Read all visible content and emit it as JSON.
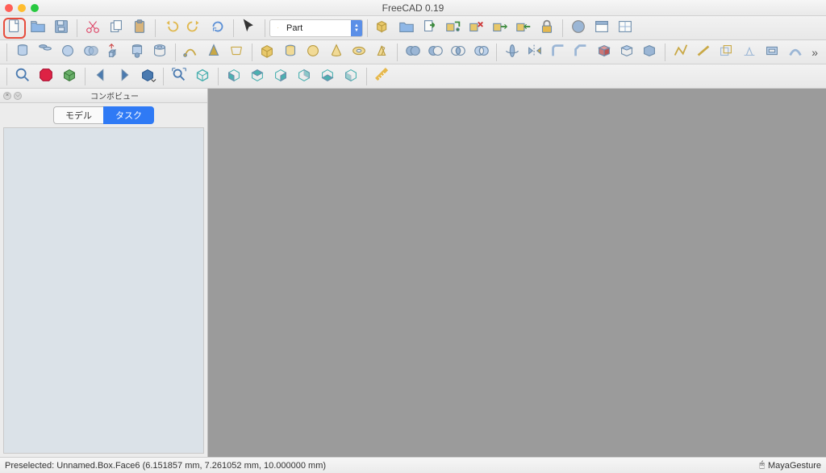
{
  "title": "FreeCAD 0.19",
  "workbench": {
    "label": "Part"
  },
  "combo": {
    "title": "コンボビュー",
    "tabs": {
      "model": "モデル",
      "task": "タスク"
    },
    "active_tab": "task"
  },
  "statusbar": {
    "preselect": "Preselected: Unnamed.Box.Face6 (6.151857 mm, 7.261052 mm, 10.000000 mm)",
    "nav_style": "MayaGesture"
  },
  "toolbar_icons_row1": [
    "new-doc",
    "open-doc",
    "save-doc",
    "sep",
    "cut",
    "copy",
    "paste",
    "sep",
    "undo",
    "redo",
    "refresh",
    "sep",
    "pointer",
    "sep",
    "workbench",
    "sep",
    "box-link",
    "folder",
    "export",
    "link-group",
    "link-break",
    "link-var",
    "link-sel",
    "lock",
    "sep",
    "color-pick",
    "window",
    "track"
  ],
  "toolbar_icons_row2": [
    "sep",
    "cylinder",
    "cyl-2",
    "sphere",
    "intersect",
    "extrude",
    "cyl-join",
    "tube",
    "sep",
    "sweep",
    "cone-shape",
    "loft",
    "sep",
    "box",
    "cylinder-p",
    "sphere-p",
    "cone-p",
    "torus-p",
    "prism-p",
    "sep",
    "bool-union",
    "bool-cut",
    "bool-intersect",
    "bool-xor",
    "sep",
    "revolve",
    "mirror",
    "fillet",
    "chamfer",
    "face",
    "shell",
    "solid",
    "sep",
    "wire",
    "edge",
    "offset",
    "project",
    "thickness",
    "sweep2",
    "overflow"
  ],
  "toolbar_icons_row3": [
    "sep",
    "zoom",
    "stop",
    "nav-cube",
    "sep",
    "arrow-left",
    "arrow-right",
    "view-dd",
    "sep",
    "zoom-fit",
    "iso",
    "sep",
    "front",
    "top",
    "right",
    "rear",
    "bottom",
    "left",
    "sep",
    "measure"
  ]
}
